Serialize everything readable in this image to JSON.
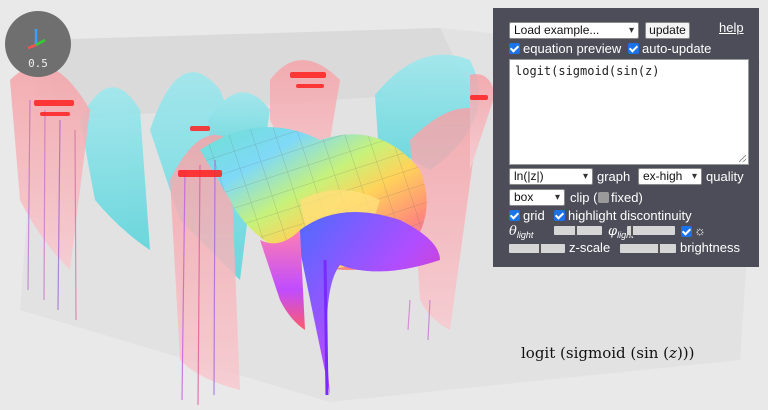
{
  "viewport": {
    "scale_label": "0.5"
  },
  "panel": {
    "example_select": "Load example...",
    "update_button": "update",
    "help_link": "help",
    "equation_preview_label": "equation preview",
    "equation_preview_checked": true,
    "auto_update_label": "auto-update",
    "auto_update_checked": true,
    "equation_text": "logit(sigmoid(sin(z)",
    "graph_mode_select": "ln(|z|)",
    "graph_label": "graph",
    "quality_select": "ex-high",
    "quality_label": "quality",
    "clip_select": "box",
    "clip_label": "clip (",
    "fixed_checked": false,
    "fixed_label": "fixed)",
    "grid_label": "grid",
    "grid_checked": true,
    "highlight_label": "highlight discontinuity",
    "highlight_checked": true,
    "theta_light_symbol": "θ",
    "theta_light_sub": "light",
    "theta_light_value": 0.45,
    "phi_light_symbol": "φ",
    "phi_light_sub": "light",
    "phi_light_value": 0.08,
    "light_checked": true,
    "light_icon": "sun-icon",
    "z_scale_value": 0.55,
    "z_scale_label": "z-scale",
    "brightness_value": 0.7,
    "brightness_label": "brightness"
  },
  "formula": {
    "prefix": "logit (sigmoid (sin (",
    "var": "z",
    "suffix": ")))"
  },
  "colors": {
    "panel_bg": "#4d4d59",
    "checkbox": "#1a73e8",
    "page_bg": "#e9e9e9"
  }
}
